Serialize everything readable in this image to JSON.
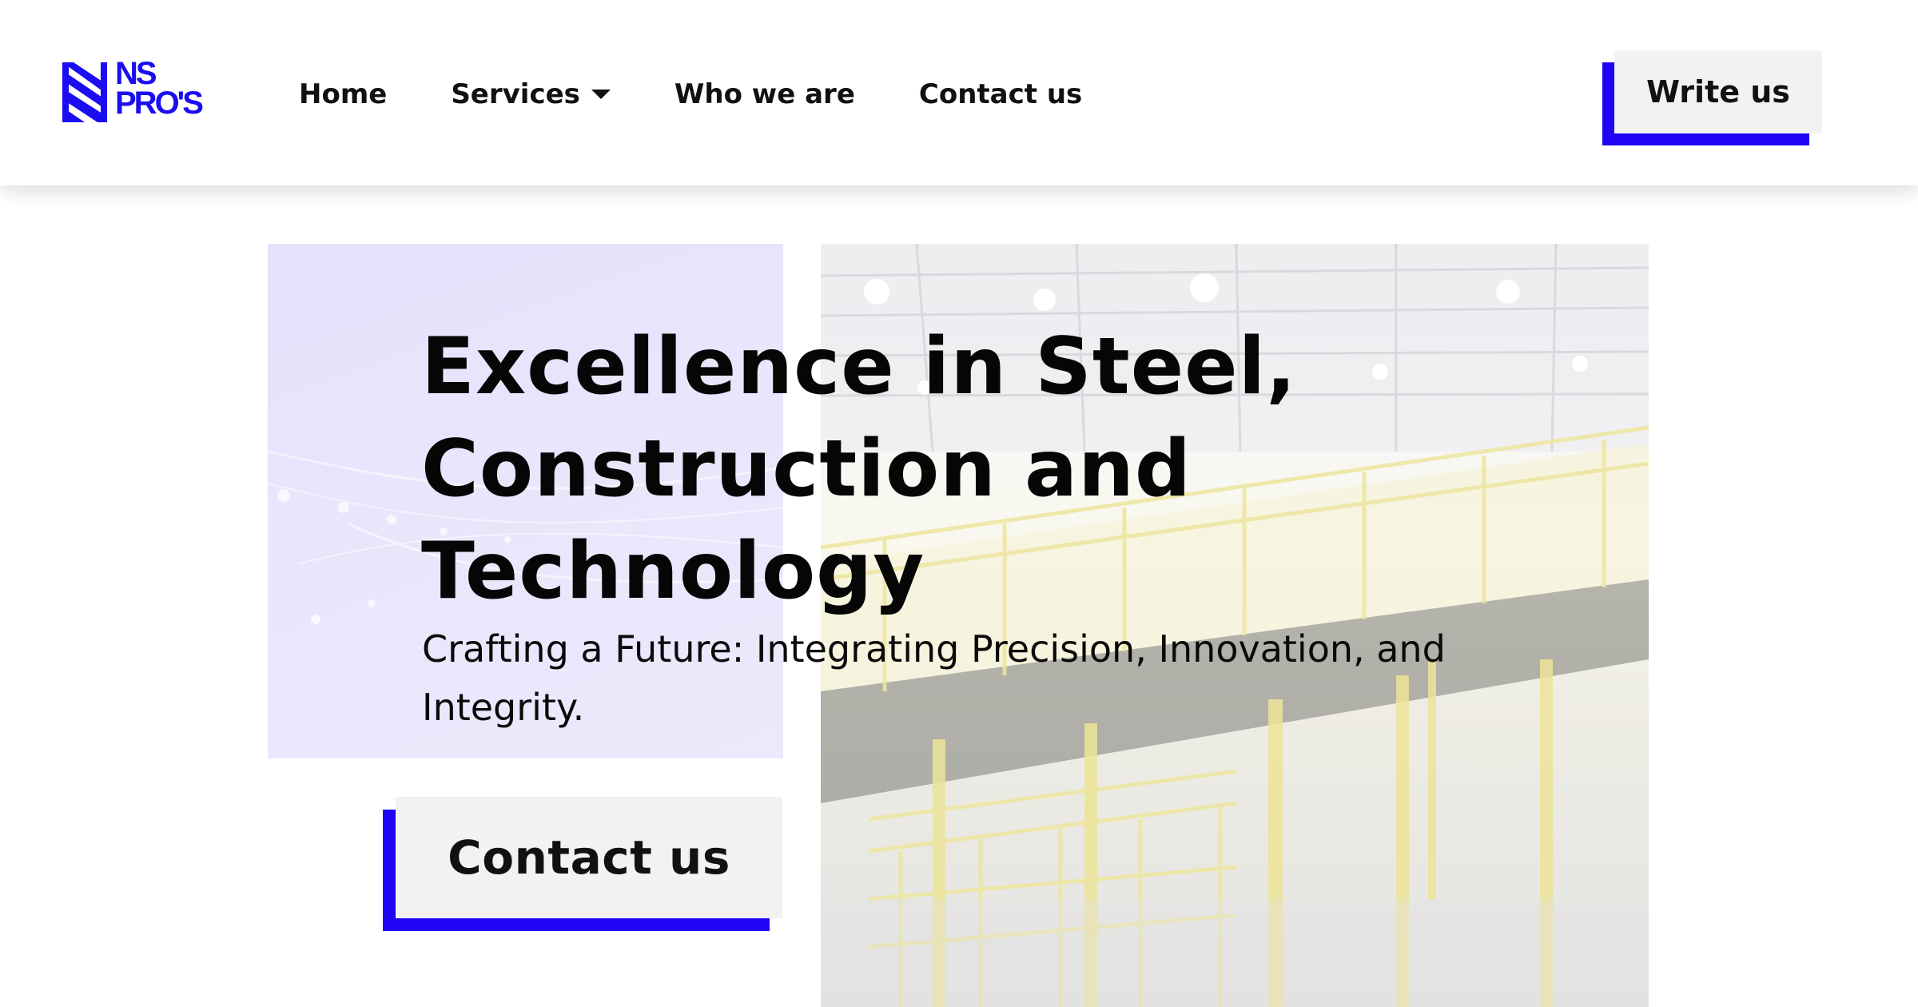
{
  "brand": {
    "name_line1": "NS",
    "name_line2": "PRO'S",
    "color": "#1a0df0"
  },
  "nav": {
    "items": [
      {
        "label": "Home",
        "has_dropdown": false
      },
      {
        "label": "Services",
        "has_dropdown": true
      },
      {
        "label": "Who we are",
        "has_dropdown": false
      },
      {
        "label": "Contact us",
        "has_dropdown": false
      }
    ],
    "cta_label": "Write us"
  },
  "hero": {
    "title_lines": [
      "Excellence in Steel,",
      "Construction and",
      "Technology"
    ],
    "subtitle_lines": [
      "Crafting a Future: Integrating Precision, Innovation, and",
      "Integrity."
    ],
    "button_label": "Contact us"
  },
  "colors": {
    "accent": "#1f05f4",
    "button_face": "#f2f2f2",
    "lilac_panel": "#e9e6fc"
  }
}
